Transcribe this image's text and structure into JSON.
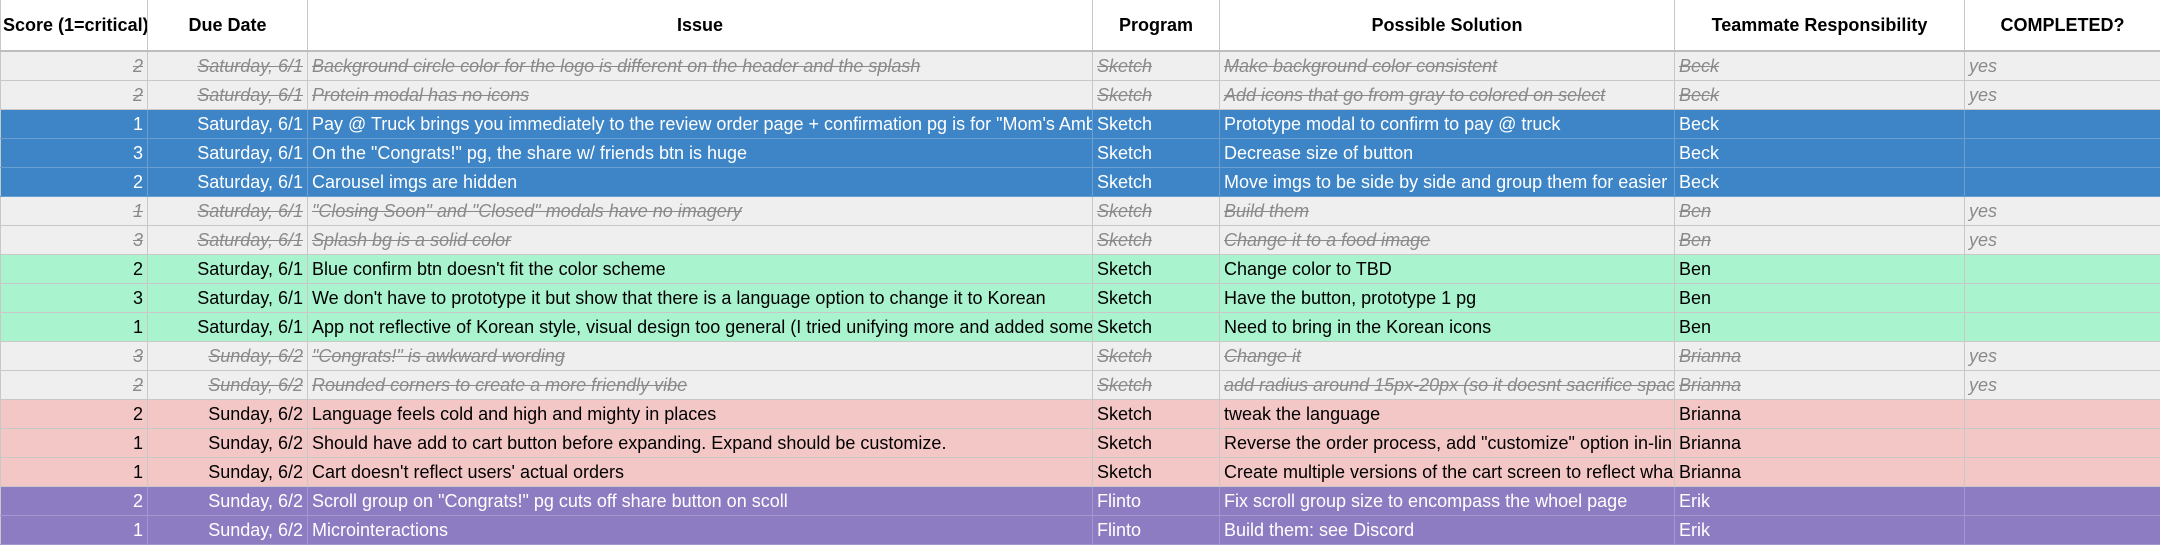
{
  "headers": {
    "score": "Score (1=critical)",
    "due_date": "Due Date",
    "issue": "Issue",
    "program": "Program",
    "possible_solution": "Possible Solution",
    "teammate": "Teammate Responsibility",
    "completed": "COMPLETED?"
  },
  "rows": [
    {
      "score": "2",
      "date": "Saturday, 6/1",
      "issue": "Background circle color for the logo is different on the header and the splash",
      "program": "Sketch",
      "solution": "Make background color consistent",
      "teammate": "Beck",
      "completed": "yes",
      "status": "done"
    },
    {
      "score": "2",
      "date": "Saturday, 6/1",
      "issue": "Protein modal has no icons",
      "program": "Sketch",
      "solution": "Add icons that go from gray to colored on select",
      "teammate": "Beck",
      "completed": "yes",
      "status": "done"
    },
    {
      "score": "1",
      "date": "Saturday, 6/1",
      "issue": "Pay @ Truck brings you immediately to the review order page + confirmation pg is for \"Mom's Amb",
      "program": "Sketch",
      "solution": "Prototype modal to confirm to pay @ truck",
      "teammate": "Beck",
      "completed": "",
      "status": "blue"
    },
    {
      "score": "3",
      "date": "Saturday, 6/1",
      "issue": "On the \"Congrats!\" pg, the share w/ friends btn is huge",
      "program": "Sketch",
      "solution": "Decrease size of button",
      "teammate": "Beck",
      "completed": "",
      "status": "blue"
    },
    {
      "score": "2",
      "date": "Saturday, 6/1",
      "issue": "Carousel imgs are hidden",
      "program": "Sketch",
      "solution": "Move imgs to be side by side and group them for easier",
      "teammate": "Beck",
      "completed": "",
      "status": "blue"
    },
    {
      "score": "1",
      "date": "Saturday, 6/1",
      "issue": "\"Closing Soon\" and \"Closed\" modals have no imagery",
      "program": "Sketch",
      "solution": "Build them",
      "teammate": "Ben",
      "completed": "yes",
      "status": "done"
    },
    {
      "score": "3",
      "date": "Saturday, 6/1",
      "issue": "Splash bg is a solid color",
      "program": "Sketch",
      "solution": "Change it to a food image",
      "teammate": "Ben",
      "completed": "yes",
      "status": "done"
    },
    {
      "score": "2",
      "date": "Saturday, 6/1",
      "issue": "Blue confirm btn doesn't fit the color scheme",
      "program": "Sketch",
      "solution": "Change color to TBD",
      "teammate": "Ben",
      "completed": "",
      "status": "green"
    },
    {
      "score": "3",
      "date": "Saturday, 6/1",
      "issue": "We don't have to prototype it but show that there is a language option to change it to Korean",
      "program": "Sketch",
      "solution": "Have the button, prototype 1 pg",
      "teammate": "Ben",
      "completed": "",
      "status": "green"
    },
    {
      "score": "1",
      "date": "Saturday, 6/1",
      "issue": "App not reflective of Korean style, visual design too general (I tried unifying more and added some",
      "program": "Sketch",
      "solution": "Need to bring in the Korean icons",
      "teammate": "Ben",
      "completed": "",
      "status": "green"
    },
    {
      "score": "3",
      "date": "Sunday, 6/2",
      "issue": "\"Congrats!\" is awkward wording",
      "program": "Sketch",
      "solution": "Change it",
      "teammate": "Brianna",
      "completed": "yes",
      "status": "done"
    },
    {
      "score": "2",
      "date": "Sunday, 6/2",
      "issue": "Rounded corners to create a more friendly vibe",
      "program": "Sketch",
      "solution": "add radius around 15px-20px (so it doesnt sacrifice spac",
      "teammate": "Brianna",
      "completed": "yes",
      "status": "done"
    },
    {
      "score": "2",
      "date": "Sunday, 6/2",
      "issue": "Language feels cold and high and mighty in places",
      "program": "Sketch",
      "solution": "tweak the language",
      "teammate": "Brianna",
      "completed": "",
      "status": "pink"
    },
    {
      "score": "1",
      "date": "Sunday, 6/2",
      "issue": "Should have add to cart button before expanding. Expand should be customize.",
      "program": "Sketch",
      "solution": "Reverse the order process, add \"customize\" option in-lin",
      "teammate": "Brianna",
      "completed": "",
      "status": "pink"
    },
    {
      "score": "1",
      "date": "Sunday, 6/2",
      "issue": "Cart doesn't reflect users' actual orders",
      "program": "Sketch",
      "solution": "Create multiple versions of the cart screen to reflect wha",
      "teammate": "Brianna",
      "completed": "",
      "status": "pink"
    },
    {
      "score": "2",
      "date": "Sunday, 6/2",
      "issue": "Scroll group on \"Congrats!\" pg cuts off share button on scoll",
      "program": "Flinto",
      "solution": "Fix scroll group size to encompass the whoel page",
      "teammate": "Erik",
      "completed": "",
      "status": "purple"
    },
    {
      "score": "1",
      "date": "Sunday, 6/2",
      "issue": "Microinteractions",
      "program": "Flinto",
      "solution": "Build them: see Discord",
      "teammate": "Erik",
      "completed": "",
      "status": "purple"
    }
  ],
  "colors": {
    "done": "#efefef",
    "blue": "#3d85c6",
    "green": "#a9f3cf",
    "pink": "#f4c7c7",
    "purple": "#8e7cc3"
  }
}
